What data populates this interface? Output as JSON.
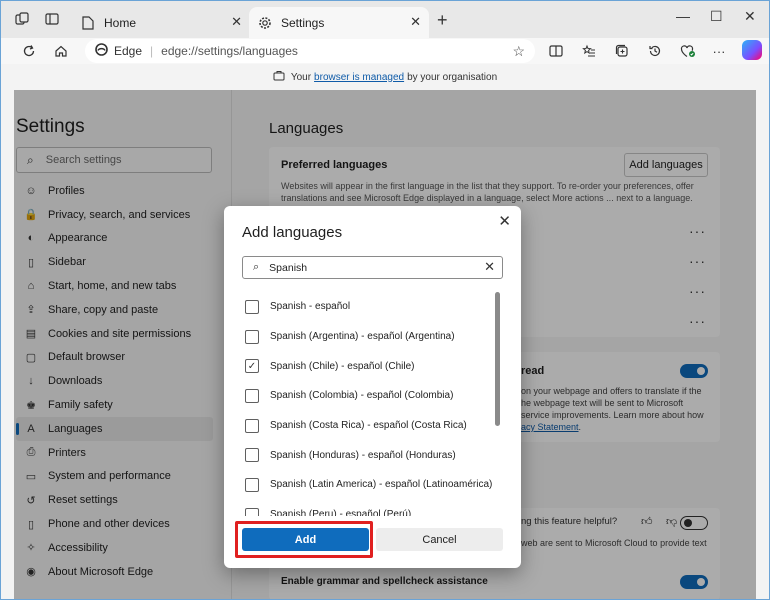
{
  "tabs": {
    "inactive": {
      "title": "Home",
      "icon": "page-icon",
      "close": "✕"
    },
    "active": {
      "title": "Settings",
      "icon": "gear-icon",
      "close": "✕"
    },
    "new_tab": "+"
  },
  "window_controls": {
    "minimize": "—",
    "maximize": "☐",
    "close": "✕"
  },
  "address_bar": {
    "brand": "Edge",
    "url": "edge://settings/languages"
  },
  "banner": {
    "prefix": "Your",
    "link": "browser is managed",
    "suffix": "by your organisation"
  },
  "sidebar": {
    "title": "Settings",
    "search_placeholder": "Search settings",
    "items": [
      {
        "label": "Profiles",
        "icon": "profile-icon",
        "glyph": "☺"
      },
      {
        "label": "Privacy, search, and services",
        "icon": "lock-icon",
        "glyph": "🔒"
      },
      {
        "label": "Appearance",
        "icon": "appearance-icon",
        "glyph": "◐"
      },
      {
        "label": "Sidebar",
        "icon": "sidebar-icon",
        "glyph": "▯"
      },
      {
        "label": "Start, home, and new tabs",
        "icon": "home-icon",
        "glyph": "⌂"
      },
      {
        "label": "Share, copy and paste",
        "icon": "share-icon",
        "glyph": "⇪"
      },
      {
        "label": "Cookies and site permissions",
        "icon": "cookie-icon",
        "glyph": "▤"
      },
      {
        "label": "Default browser",
        "icon": "browser-icon",
        "glyph": "▢"
      },
      {
        "label": "Downloads",
        "icon": "download-icon",
        "glyph": "↓"
      },
      {
        "label": "Family safety",
        "icon": "family-icon",
        "glyph": "♚"
      },
      {
        "label": "Languages",
        "icon": "language-icon",
        "glyph": "A",
        "selected": true
      },
      {
        "label": "Printers",
        "icon": "printer-icon",
        "glyph": "⎙"
      },
      {
        "label": "System and performance",
        "icon": "system-icon",
        "glyph": "▭"
      },
      {
        "label": "Reset settings",
        "icon": "reset-icon",
        "glyph": "↺"
      },
      {
        "label": "Phone and other devices",
        "icon": "phone-icon",
        "glyph": "▯"
      },
      {
        "label": "Accessibility",
        "icon": "accessibility-icon",
        "glyph": "✧"
      },
      {
        "label": "About Microsoft Edge",
        "icon": "edge-icon",
        "glyph": "◉"
      }
    ]
  },
  "main": {
    "title": "Languages",
    "preferred": {
      "heading": "Preferred languages",
      "add_button": "Add languages",
      "description": "Websites will appear in the first language in the list that they support. To re-order your preferences, offer translations and see Microsoft Edge displayed in a language, select More actions ... next to a language.",
      "more": "···"
    },
    "translate": {
      "heading_tail": "read",
      "lines": [
        "on your webpage and offers to translate if the",
        "he webpage text will be sent to Microsoft",
        "service improvements. Learn more about how"
      ],
      "link": "acy Statement",
      "link_tail": "."
    },
    "writing": {
      "helpful": "ng this feature helpful?",
      "cloud": "web are sent to Microsoft Cloud to provide text",
      "grammar": "Enable grammar and spellcheck assistance"
    }
  },
  "dialog": {
    "title": "Add languages",
    "search_value": "Spanish",
    "options": [
      {
        "label": "Spanish - español",
        "checked": false
      },
      {
        "label": "Spanish (Argentina) - español (Argentina)",
        "checked": false
      },
      {
        "label": "Spanish (Chile) - español (Chile)",
        "checked": true
      },
      {
        "label": "Spanish (Colombia) - español (Colombia)",
        "checked": false
      },
      {
        "label": "Spanish (Costa Rica) - español (Costa Rica)",
        "checked": false
      },
      {
        "label": "Spanish (Honduras) - español (Honduras)",
        "checked": false
      },
      {
        "label": "Spanish (Latin America) - español (Latinoamérica)",
        "checked": false
      },
      {
        "label": "Spanish (Peru) - español (Perú)",
        "checked": false
      }
    ],
    "add_button": "Add",
    "cancel_button": "Cancel"
  },
  "colors": {
    "accent": "#0f6cbd",
    "highlight": "#e02020",
    "link": "#0f5ba8"
  }
}
